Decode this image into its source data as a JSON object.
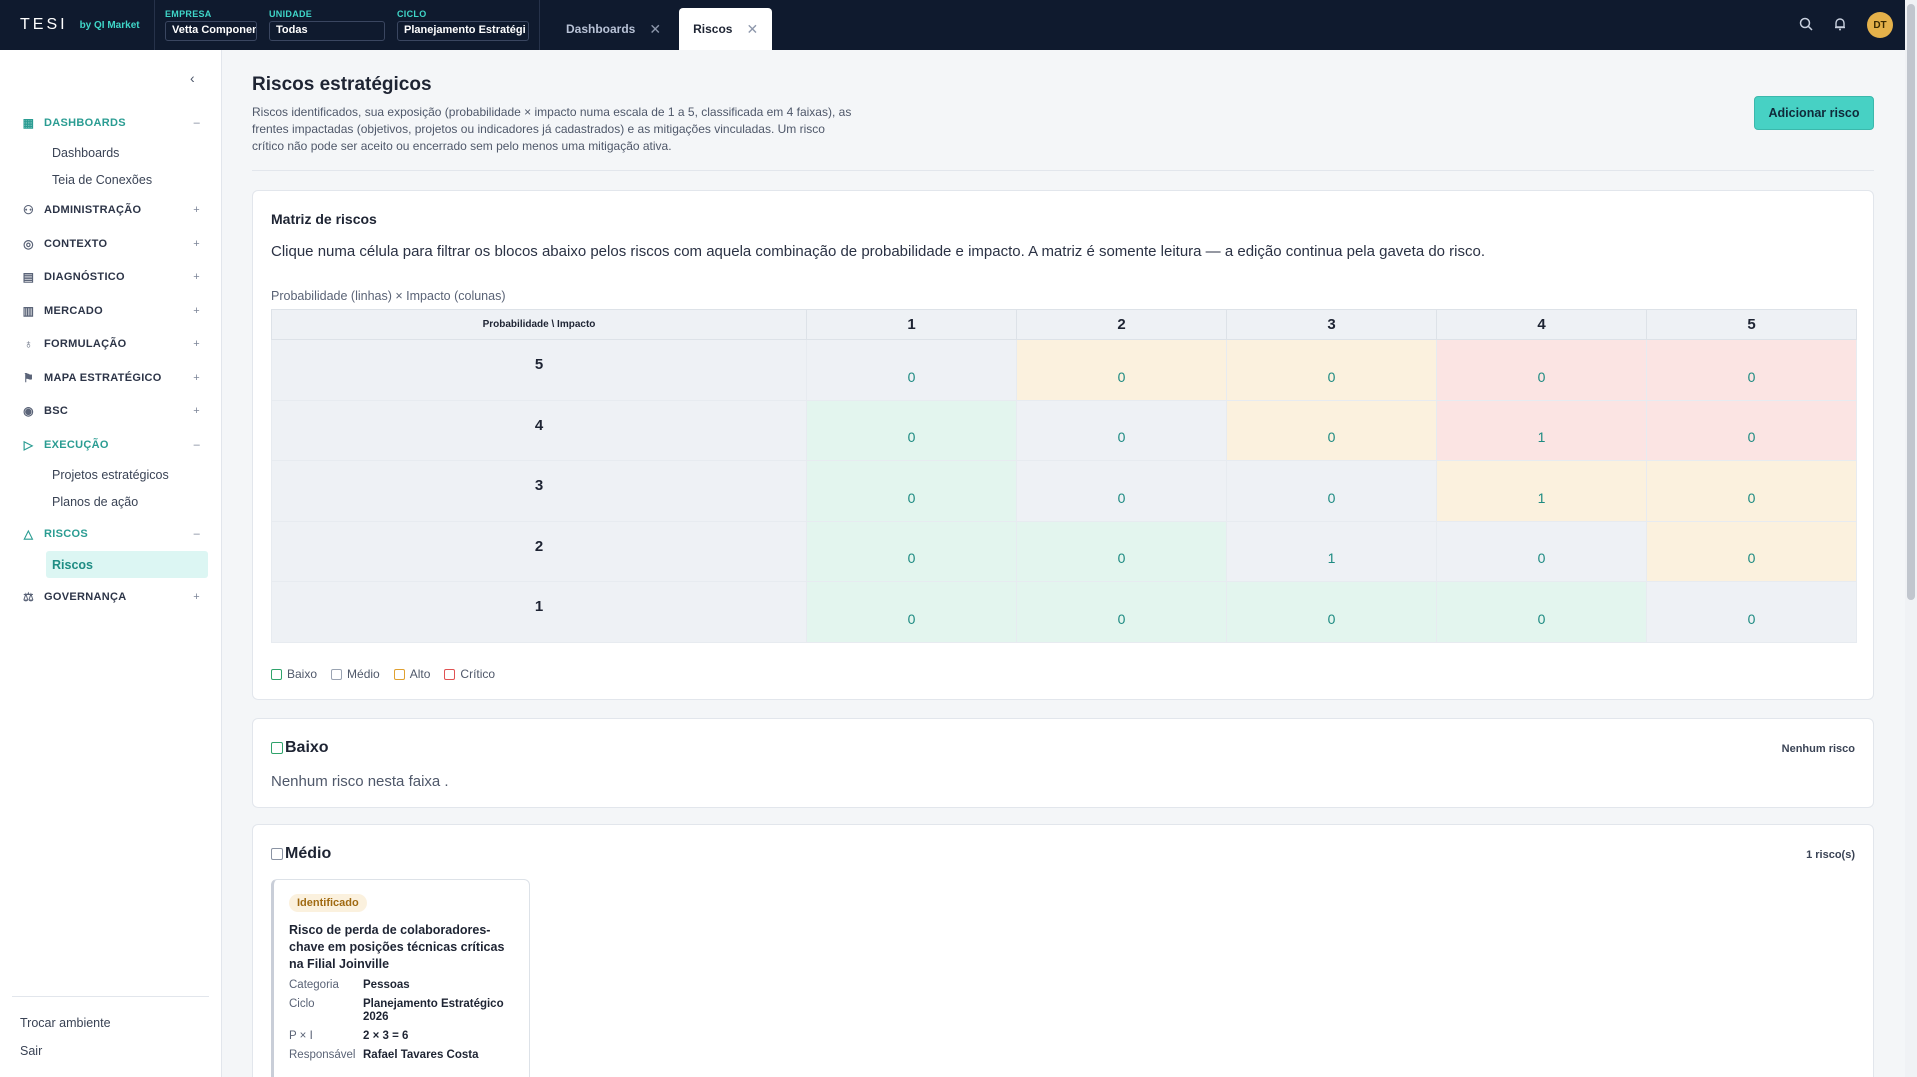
{
  "topbar": {
    "logo": "TESI",
    "by": "by QI Market",
    "empresa_label": "EMPRESA",
    "empresa_value": "Vetta Componentes",
    "unidade_label": "UNIDADE",
    "unidade_value": "Todas",
    "ciclo_label": "CICLO",
    "ciclo_value": "Planejamento Estratégi",
    "tabs": [
      {
        "label": "Dashboards",
        "active": false
      },
      {
        "label": "Riscos",
        "active": true
      }
    ],
    "avatar": "DT"
  },
  "sidebar": {
    "groups": [
      {
        "label": "DASHBOARDS",
        "icon": "dashboard-icon",
        "toggle": "–",
        "open": true,
        "items": [
          "Dashboards",
          "Teia de Conexões"
        ]
      },
      {
        "label": "ADMINISTRAÇÃO",
        "icon": "users-icon",
        "toggle": "+",
        "open": false,
        "items": []
      },
      {
        "label": "CONTEXTO",
        "icon": "compass-icon",
        "toggle": "+",
        "open": false,
        "items": []
      },
      {
        "label": "DIAGNÓSTICO",
        "icon": "clipboard-icon",
        "toggle": "+",
        "open": false,
        "items": []
      },
      {
        "label": "MERCADO",
        "icon": "bar-chart-icon",
        "toggle": "+",
        "open": false,
        "items": []
      },
      {
        "label": "FORMULAÇÃO",
        "icon": "lightbulb-icon",
        "toggle": "+",
        "open": false,
        "items": []
      },
      {
        "label": "MAPA ESTRATÉGICO",
        "icon": "flag-icon",
        "toggle": "+",
        "open": false,
        "items": []
      },
      {
        "label": "BSC",
        "icon": "target-icon",
        "toggle": "+",
        "open": false,
        "items": []
      },
      {
        "label": "EXECUÇÃO",
        "icon": "play-icon",
        "toggle": "–",
        "open": true,
        "items": [
          "Projetos estratégicos",
          "Planos de ação"
        ]
      },
      {
        "label": "RISCOS",
        "icon": "warning-icon",
        "toggle": "–",
        "open": true,
        "items": [
          "Riscos"
        ]
      },
      {
        "label": "GOVERNANÇA",
        "icon": "scale-icon",
        "toggle": "+",
        "open": false,
        "items": []
      }
    ],
    "bottom": [
      "Trocar ambiente",
      "Sair"
    ]
  },
  "page": {
    "title": "Riscos estratégicos",
    "description": "Riscos identificados, sua exposição (probabilidade × impacto numa escala de 1 a 5, classificada em 4 faixas), as frentes impactadas (objetivos, projetos ou indicadores já cadastrados) e as mitigações vinculadas. Um risco crítico não pode ser aceito ou encerrado sem pelo menos uma mitigação ativa.",
    "add_button": "Adicionar risco"
  },
  "matrix": {
    "title": "Matriz de riscos",
    "subtitle": "Clique numa célula para filtrar os blocos abaixo pelos riscos com aquela combinação de probabilidade e impacto. A matriz é somente leitura — a edição continua pela gaveta do risco.",
    "caption": "Probabilidade (linhas) × Impacto (colunas)",
    "corner": "Probabilidade \\ Impacto",
    "columns": [
      "1",
      "2",
      "3",
      "4",
      "5"
    ],
    "rows": [
      {
        "p": "5",
        "cells": [
          {
            "v": "0",
            "band": "m"
          },
          {
            "v": "0",
            "band": "a"
          },
          {
            "v": "0",
            "band": "a"
          },
          {
            "v": "0",
            "band": "c"
          },
          {
            "v": "0",
            "band": "c"
          }
        ]
      },
      {
        "p": "4",
        "cells": [
          {
            "v": "0",
            "band": "b"
          },
          {
            "v": "0",
            "band": "m"
          },
          {
            "v": "0",
            "band": "a"
          },
          {
            "v": "1",
            "band": "c"
          },
          {
            "v": "0",
            "band": "c"
          }
        ]
      },
      {
        "p": "3",
        "cells": [
          {
            "v": "0",
            "band": "b"
          },
          {
            "v": "0",
            "band": "m"
          },
          {
            "v": "0",
            "band": "m"
          },
          {
            "v": "1",
            "band": "a"
          },
          {
            "v": "0",
            "band": "a"
          }
        ]
      },
      {
        "p": "2",
        "cells": [
          {
            "v": "0",
            "band": "b"
          },
          {
            "v": "0",
            "band": "b"
          },
          {
            "v": "1",
            "band": "m"
          },
          {
            "v": "0",
            "band": "m"
          },
          {
            "v": "0",
            "band": "a"
          }
        ]
      },
      {
        "p": "1",
        "cells": [
          {
            "v": "0",
            "band": "b"
          },
          {
            "v": "0",
            "band": "b"
          },
          {
            "v": "0",
            "band": "b"
          },
          {
            "v": "0",
            "band": "b"
          },
          {
            "v": "0",
            "band": "m"
          }
        ]
      }
    ],
    "legend": [
      {
        "label": "Baixo",
        "color": "#2fa36b"
      },
      {
        "label": "Médio",
        "color": "#9aa3b2"
      },
      {
        "label": "Alto",
        "color": "#e0a030"
      },
      {
        "label": "Crítico",
        "color": "#e05252"
      }
    ]
  },
  "bands": {
    "baixo": {
      "label": "Baixo",
      "count": "Nenhum risco",
      "empty": "Nenhum risco nesta faixa ."
    },
    "medio": {
      "label": "Médio",
      "count": "1 risco(s)"
    }
  },
  "risk_card": {
    "status": "Identificado",
    "title": "Risco de perda de colaboradores-chave em posições técnicas críticas na Filial Joinville",
    "fields": [
      {
        "k": "Categoria",
        "v": "Pessoas"
      },
      {
        "k": "Ciclo",
        "v": "Planejamento Estratégico 2026"
      },
      {
        "k": "P × I",
        "v": "2 × 3 = 6"
      },
      {
        "k": "Responsável",
        "v": "Rafael Tavares Costa"
      }
    ]
  },
  "colors": {
    "accent": "#47d1c4",
    "topbar": "#0f1a2e"
  }
}
